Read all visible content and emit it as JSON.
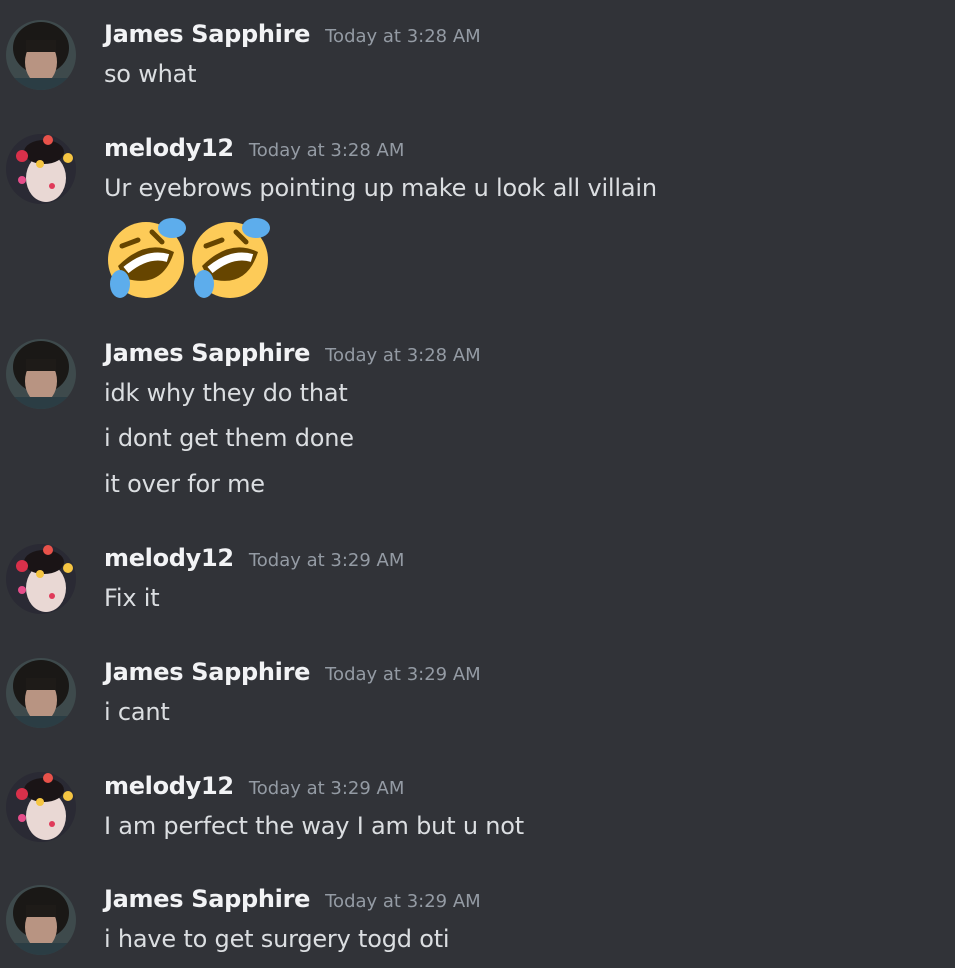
{
  "messages": [
    {
      "author": "James Sapphire",
      "avatar": "james-avatar",
      "timestamp": "Today at 3:28 AM",
      "lines": [
        "so what"
      ]
    },
    {
      "author": "melody12",
      "avatar": "melody-avatar",
      "timestamp": "Today at 3:28 AM",
      "lines": [
        "Ur eyebrows pointing up make u look all villain"
      ],
      "emojis": [
        "rofl-emoji",
        "rofl-emoji"
      ]
    },
    {
      "author": "James Sapphire",
      "avatar": "james-avatar",
      "timestamp": "Today at 3:28 AM",
      "lines": [
        "idk why they do that",
        "i dont get them done",
        "it over for me"
      ]
    },
    {
      "author": "melody12",
      "avatar": "melody-avatar",
      "timestamp": "Today at 3:29 AM",
      "lines": [
        "Fix it"
      ]
    },
    {
      "author": "James Sapphire",
      "avatar": "james-avatar",
      "timestamp": "Today at 3:29 AM",
      "lines": [
        "i cant"
      ]
    },
    {
      "author": "melody12",
      "avatar": "melody-avatar",
      "timestamp": "Today at 3:29 AM",
      "lines": [
        "I am perfect the way I am but u not"
      ]
    },
    {
      "author": "James Sapphire",
      "avatar": "james-avatar",
      "timestamp": "Today at 3:29 AM",
      "lines": [
        "i have to get surgery togd oti"
      ]
    }
  ],
  "colors": {
    "background": "#313338",
    "author": "#f2f3f5",
    "timestamp": "#949ba4",
    "text": "#dbdee1"
  }
}
